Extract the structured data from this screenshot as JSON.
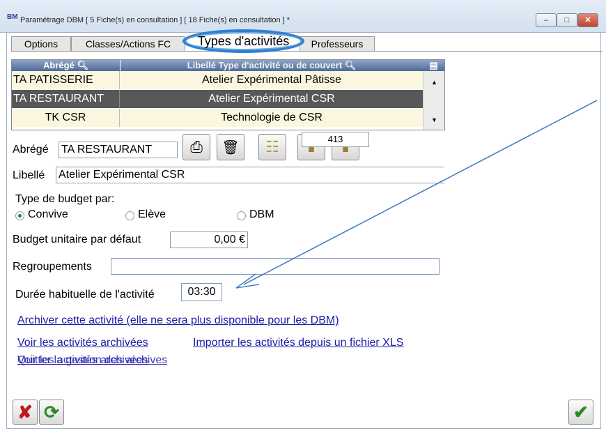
{
  "window": {
    "title": "Paramétrage DBM  [ 5 Fiche(s) en consultation ]  [ 18 Fiche(s) en consultation ] *",
    "app_icon": "BM"
  },
  "tabs": [
    {
      "label": "Options"
    },
    {
      "label": "Classes/Actions FC"
    },
    {
      "label": "Types d'activités"
    },
    {
      "label": "Professeurs"
    }
  ],
  "grid": {
    "headers": [
      "Abrégé",
      "Libellé Type d'activité ou de couvert"
    ],
    "rows": [
      {
        "abrege": "TA PATISSERIE",
        "libelle": "Atelier Expérimental Pâtisse"
      },
      {
        "abrege": "TA RESTAURANT",
        "libelle": "Atelier Expérimental CSR"
      },
      {
        "abrege": "TK CSR",
        "libelle": "Technologie de CSR"
      }
    ],
    "selected_index": 1
  },
  "form": {
    "abrege_label": "Abrégé",
    "abrege_value": "TA RESTAURANT",
    "counter_value": "413",
    "libelle_label": "Libellé",
    "libelle_value": "Atelier Expérimental CSR",
    "budget_type_label": "Type de budget par:",
    "budget_options": [
      "Convive",
      "Elève",
      "DBM"
    ],
    "budget_selected": "Convive",
    "budget_unit_label": "Budget unitaire par défaut",
    "budget_unit_value": "0,00 €",
    "regroupements_label": "Regroupements",
    "regroupements_value": "",
    "duree_label": "Durée habituelle de l'activité",
    "duree_value": "03:30"
  },
  "links": {
    "archive": "Archiver cette activité (elle ne sera plus disponible pour les DBM)",
    "view_archived": "Voir les activités archivées",
    "import_xls": "Importer les activités depuis un fichier XLS",
    "overlap_a": "Voir les activités archivées",
    "overlap_b": "Quitter la gestion des archives"
  },
  "icons": {
    "print": "printer-icon",
    "delete": "trash-icon",
    "new": "new-sheet-icon",
    "prev": "scroll-icon",
    "next": "scroll-icon",
    "cancel": "red-x-icon",
    "refresh": "green-refresh-icon",
    "validate": "green-check-icon"
  }
}
